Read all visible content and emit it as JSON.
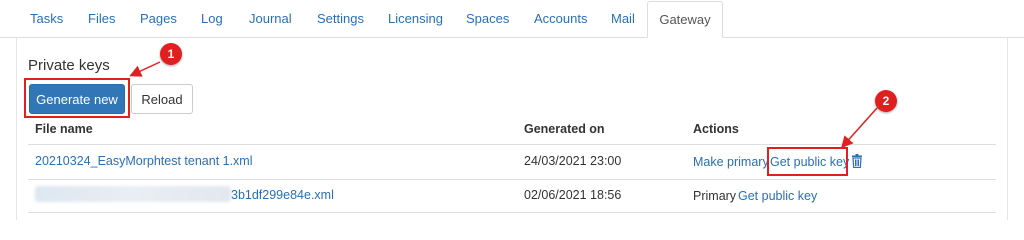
{
  "tabs": [
    {
      "label": "Tasks"
    },
    {
      "label": "Files"
    },
    {
      "label": "Pages"
    },
    {
      "label": "Log"
    },
    {
      "label": "Journal"
    },
    {
      "label": "Settings"
    },
    {
      "label": "Licensing"
    },
    {
      "label": "Spaces"
    },
    {
      "label": "Accounts"
    },
    {
      "label": "Mail"
    },
    {
      "label": "Gateway",
      "active": true
    }
  ],
  "section": {
    "title": "Private keys"
  },
  "buttons": {
    "generate_new": "Generate new",
    "reload": "Reload"
  },
  "table": {
    "headers": {
      "file_name": "File name",
      "generated_on": "Generated on",
      "actions": "Actions"
    },
    "rows": [
      {
        "file_name": "20210324_EasyMorphtest tenant 1.xml",
        "generated_on": "24/03/2021 23:00",
        "status": "",
        "make_primary": "Make primary",
        "get_public_key": "Get public key",
        "delete_icon": "trash-icon"
      },
      {
        "file_name": "3b1df299e84e.xml",
        "file_name_partially_blurred": true,
        "generated_on": "02/06/2021 18:56",
        "status": "Primary",
        "get_public_key": "Get public key"
      }
    ]
  },
  "annotations": [
    {
      "number": "1",
      "target": "generate-new-button"
    },
    {
      "number": "2",
      "target": "get-public-key-link"
    }
  ],
  "colors": {
    "link": "#2a6fb6",
    "primary_button": "#3177b8",
    "annotation": "#e01f1f",
    "border": "#dddddd"
  }
}
